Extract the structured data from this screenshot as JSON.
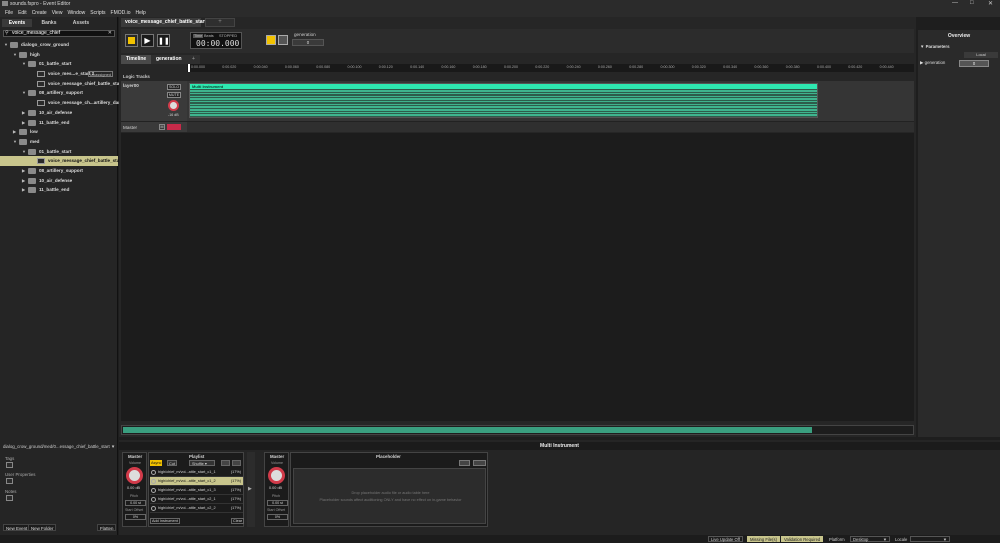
{
  "window": {
    "title": "sounds.fspro - Event Editor"
  },
  "menu": [
    "File",
    "Edit",
    "Create",
    "View",
    "Window",
    "Scripts",
    "FMOD.io",
    "Help"
  ],
  "left_tabs": [
    "Events",
    "Banks",
    "Assets"
  ],
  "search": {
    "value": "voice_message_chief"
  },
  "tree": [
    {
      "label": "dialogo_crow_ground",
      "kind": "folder",
      "depth": 0,
      "open": true
    },
    {
      "label": "high",
      "kind": "folder",
      "depth": 1,
      "open": true
    },
    {
      "label": "01_battle_start",
      "kind": "folder",
      "depth": 2,
      "open": true
    },
    {
      "label": "voice_mes...e_start 2",
      "kind": "event",
      "depth": 3,
      "badge": "Unassigned"
    },
    {
      "label": "voice_message_chief_battle_start",
      "kind": "event",
      "depth": 3
    },
    {
      "label": "08_artillery_support",
      "kind": "folder",
      "depth": 2,
      "open": true
    },
    {
      "label": "voice_message_ch...artillery_danger",
      "kind": "event",
      "depth": 3
    },
    {
      "label": "10_air_defense",
      "kind": "folder",
      "depth": 2
    },
    {
      "label": "11_battle_end",
      "kind": "folder",
      "depth": 2
    },
    {
      "label": "low",
      "kind": "folder",
      "depth": 1
    },
    {
      "label": "med",
      "kind": "folder",
      "depth": 1,
      "open": true
    },
    {
      "label": "01_battle_start",
      "kind": "folder",
      "depth": 2,
      "open": true
    },
    {
      "label": "voice_message_chief_battle_start",
      "kind": "event",
      "depth": 3,
      "selected": true
    },
    {
      "label": "08_artillery_support",
      "kind": "folder",
      "depth": 2
    },
    {
      "label": "10_air_defense",
      "kind": "folder",
      "depth": 2
    },
    {
      "label": "11_battle_end",
      "kind": "folder",
      "depth": 2
    }
  ],
  "event_path": "dialog_crow_ground/med/0...essage_chief_battle_start",
  "props": {
    "tags": "Tags",
    "user_properties": "User Properties",
    "notes": "Notes"
  },
  "left_buttons": {
    "new_event": "New Event",
    "new_folder": "New Folder",
    "flatten": "Flatten"
  },
  "event_tab": {
    "label": "voice_message_chief_battle_start",
    "add": "+"
  },
  "transport": {
    "time": "00:00.000",
    "time_mode": "Time",
    "beats": "Beats",
    "state": "STOPPED",
    "param_label": "generation",
    "param_value": "0"
  },
  "view_tabs": [
    "Timeline",
    "generation"
  ],
  "ruler_ticks": [
    "0:00.000",
    "0:00.020",
    "0:00.040",
    "0:00.060",
    "0:00.080",
    "0:00.100",
    "0:00.120",
    "0:00.140",
    "0:00.160",
    "0:00.180",
    "0:00.200",
    "0:00.220",
    "0:00.240",
    "0:00.260",
    "0:00.280",
    "0:00.300",
    "0:00.320",
    "0:00.340",
    "0:00.360",
    "0:00.380",
    "0:00.400",
    "0:00.420",
    "0:00.440"
  ],
  "logic_tracks": "Logic Tracks",
  "track": {
    "name": "layer00",
    "solo": "SOLO",
    "mute": "MUTE",
    "volume": "-16 dB",
    "region": "Multi Instrument"
  },
  "master_track": {
    "name": "Master",
    "m": "M"
  },
  "overview": {
    "title": "Overview",
    "params_header": "Parameters",
    "local": "Local",
    "param": "generation",
    "value": "0"
  },
  "bottom": {
    "title": "Multi Instrument",
    "master": "Master",
    "playlist": "Playlist",
    "placeholder": "Placeholder",
    "volume_label": "Volume",
    "volume": "0.00 dB",
    "pitch_label": "Pitch",
    "pitch": "0.00 st",
    "start_offset_label": "Start Offset",
    "start_offset": "0%",
    "mode": {
      "async": "Async",
      "cut": "Cut",
      "shuffle": "Shuffle"
    },
    "playlist_items": [
      "high/chief_m/voi...attle_start_c1_1",
      "high/chief_m/voi...attle_start_c1_2",
      "high/chief_m/voi...attle_start_c1_3",
      "high/chief_m/voi...attle_start_c2_1",
      "high/chief_m/voi...attle_start_c2_2"
    ],
    "playlist_pct": "(17%)",
    "add_instrument": "Add Instrument",
    "clear": "Clear",
    "drop_hint": "Drop placeholder audio file or audio table here",
    "drop_hint2": "Placeholder sounds affect auditioning ONLY and have no effect on in-game behavior",
    "master2_volume": "0.00 dB",
    "master2_pitch": "0.00 st",
    "master2_offset": "0%"
  },
  "status": {
    "live_update": "Live Update Off",
    "missing": "Missing File(s)",
    "validation": "Validation Required",
    "platform_label": "Platform",
    "platform": "Desktop",
    "locale_label": "Locale",
    "locale": ""
  }
}
